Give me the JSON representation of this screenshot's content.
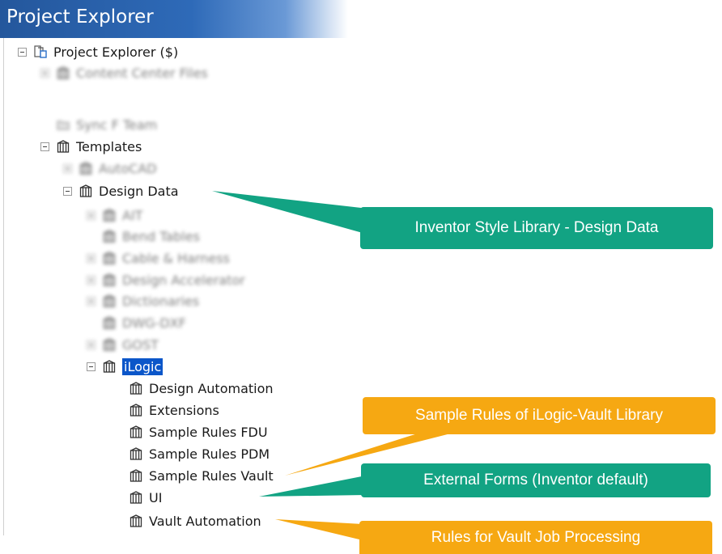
{
  "panel": {
    "title": "Project Explorer"
  },
  "tree": {
    "root": "Project Explorer ($)",
    "content_center": "Content Center Files",
    "sync_team": "Sync F Team",
    "templates": "Templates",
    "autocad": "AutoCAD",
    "design_data": "Design Data",
    "children": {
      "ait": "AIT",
      "bend_tables": "Bend Tables",
      "cable_harness": "Cable & Harness",
      "design_accelerator": "Design Accelerator",
      "dictionaries": "Dictionaries",
      "dwg_dxf": "DWG-DXF",
      "gost": "GOST",
      "ilogic": "iLogic"
    },
    "ilogic_children": {
      "design_automation": "Design Automation",
      "extensions": "Extensions",
      "sample_rules_fdu": "Sample Rules FDU",
      "sample_rules_pdm": "Sample Rules PDM",
      "sample_rules_vault": "Sample Rules Vault",
      "ui": "UI",
      "vault_automation": "Vault Automation"
    }
  },
  "callouts": {
    "design_data": "Inventor Style Library - Design Data",
    "sample_rules": "Sample Rules of iLogic-Vault Library",
    "external_forms": "External Forms (Inventor default)",
    "vault_job": "Rules for Vault Job Processing"
  },
  "colors": {
    "header": "#2b62ad",
    "green": "#12a383",
    "orange": "#f6a812",
    "selection": "#0b56c9"
  },
  "icons": {
    "library": "library-icon",
    "folder": "folder-icon",
    "project": "project-explorer-icon"
  }
}
